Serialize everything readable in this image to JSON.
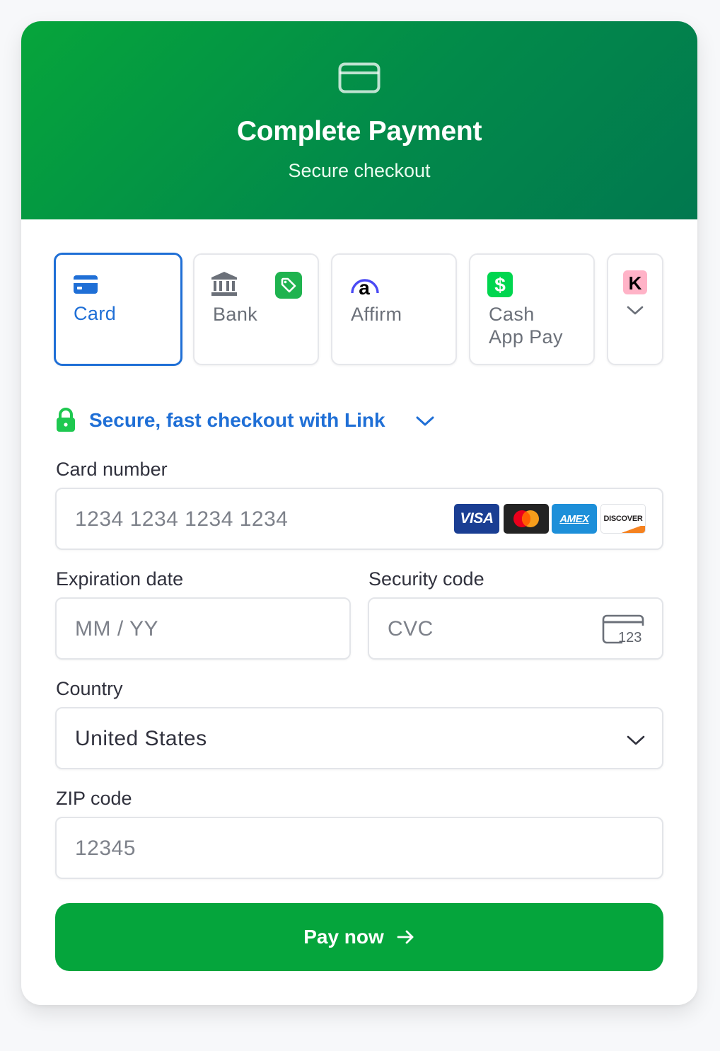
{
  "header": {
    "title": "Complete Payment",
    "subtitle": "Secure checkout",
    "icon": "credit-card-icon"
  },
  "tabs": [
    {
      "label": "Card",
      "icon": "card-icon",
      "selected": true
    },
    {
      "label": "Bank",
      "icon": "bank-icon",
      "badge_icon": "tag-icon",
      "selected": false
    },
    {
      "label": "Affirm",
      "icon": "affirm-icon",
      "selected": false
    },
    {
      "label": "Cash App Pay",
      "line1": "Cash",
      "line2": "App Pay",
      "icon": "cash-app-icon",
      "selected": false
    },
    {
      "label": "",
      "icon": "klarna-icon",
      "more_icon": "chevron-down-icon",
      "selected": false
    }
  ],
  "link": {
    "text": "Secure, fast checkout with Link",
    "icon": "lock-icon"
  },
  "card_number": {
    "label": "Card number",
    "placeholder": "1234 1234 1234 1234",
    "brands": [
      "VISA",
      "Mastercard",
      "AMEX",
      "DISCOVER"
    ]
  },
  "expiration": {
    "label": "Expiration date",
    "placeholder": "MM / YY"
  },
  "security_code": {
    "label": "Security code",
    "placeholder": "CVC",
    "icon_text": "123"
  },
  "country": {
    "label": "Country",
    "value": "United States"
  },
  "zip": {
    "label": "ZIP code",
    "placeholder": "12345"
  },
  "pay_button": {
    "label": "Pay now"
  },
  "colors": {
    "primary_green": "#05a53c",
    "accent_blue": "#1f6fd6",
    "header_gradient_start": "#06a53b",
    "header_gradient_end": "#01784f"
  }
}
